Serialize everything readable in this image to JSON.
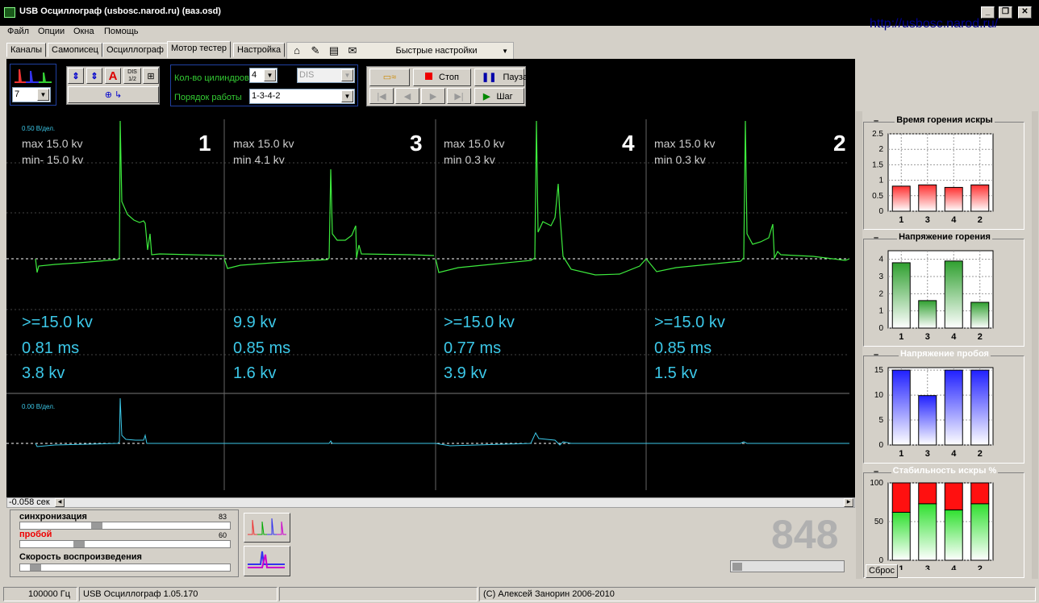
{
  "window": {
    "title": "USB Осциллограф (usbosc.narod.ru) (ваз.osd)",
    "url": "http://usbosc.narod.ru/"
  },
  "menu": [
    "Файл",
    "Опции",
    "Окна",
    "Помощь"
  ],
  "tabs": [
    "Каналы",
    "Самописец",
    "Осциллограф",
    "Мотор тестер",
    "Настройка"
  ],
  "active_tab": "Мотор тестер",
  "toolbar": {
    "quick_settings": "Быстрые настройки"
  },
  "controls": {
    "channel_select": "7",
    "cylinders_label": "Кол-во цилиндров",
    "cylinders_value": "4",
    "ignition_type": "DIS",
    "firing_order_label": "Порядок работы",
    "firing_order_value": "1-3-4-2",
    "stop_label": "Стоп",
    "pause_label": "Пауза",
    "step_label": "Шаг",
    "a_label": "A",
    "dis_label": "DIS 1/2"
  },
  "scope": {
    "upper_scale": "0.50 В/дел.",
    "lower_scale": "0.00 В/дел.",
    "cylinders": [
      {
        "num": "1",
        "max": "max 15.0 kv",
        "min": "min- 15.0 kv",
        "peak": ">=15.0 kv",
        "time": "0.81 ms",
        "burn": "3.8 kv"
      },
      {
        "num": "3",
        "max": "max 15.0 kv",
        "min": "min 4.1 kv",
        "peak": "9.9 kv",
        "time": "0.85 ms",
        "burn": "1.6 kv"
      },
      {
        "num": "4",
        "max": "max 15.0 kv",
        "min": "min 0.3 kv",
        "peak": ">=15.0 kv",
        "time": "0.77 ms",
        "burn": "3.9 kv"
      },
      {
        "num": "2",
        "max": "max 15.0 kv",
        "min": "min 0.3 kv",
        "peak": ">=15.0 kv",
        "time": "0.85 ms",
        "burn": "1.5 kv"
      }
    ]
  },
  "bottom": {
    "time_offset": "-0.058 сек",
    "sync_label": "синхронизация",
    "sync_value": "83",
    "breakdown_label": "пробой",
    "breakdown_value": "60",
    "speed_label": "Скорость воспроизведения",
    "rpm": "848"
  },
  "charts": {
    "categories": [
      "1",
      "3",
      "4",
      "2"
    ],
    "spark_time": {
      "title": "Время горения искры",
      "ylim": [
        0,
        2.5
      ],
      "ticks": [
        "2.5",
        "2",
        "1.5",
        "1",
        "0.5",
        "0"
      ],
      "values": [
        0.81,
        0.85,
        0.77,
        0.85
      ],
      "color": "#ff3030"
    },
    "burn_voltage": {
      "title": "Напряжение горения",
      "ylim": [
        0,
        4.5
      ],
      "ticks": [
        "4",
        "3",
        "2",
        "1",
        "0"
      ],
      "values": [
        3.8,
        1.6,
        3.9,
        1.5
      ],
      "color": "#30a030"
    },
    "breakdown_voltage": {
      "title": "Напряжение пробоя",
      "ylim": [
        0,
        15.5
      ],
      "ticks": [
        "15",
        "10",
        "5",
        "0"
      ],
      "values": [
        15.0,
        9.9,
        15.0,
        15.0
      ],
      "color": "#2020ff"
    },
    "spark_stability": {
      "title": "Стабильность искры %",
      "ylim": [
        0,
        100
      ],
      "ticks": [
        "100",
        "50",
        "0"
      ],
      "values": [
        62,
        73,
        65,
        73
      ],
      "color": "#30e030",
      "top_color": "#ff1010"
    },
    "reset_label": "Сброс"
  },
  "status": {
    "freq": "100000  Гц",
    "version": "USB Осциллограф 1.05.170",
    "copyright": "(С) Алексей Занорин 2006-2010"
  }
}
